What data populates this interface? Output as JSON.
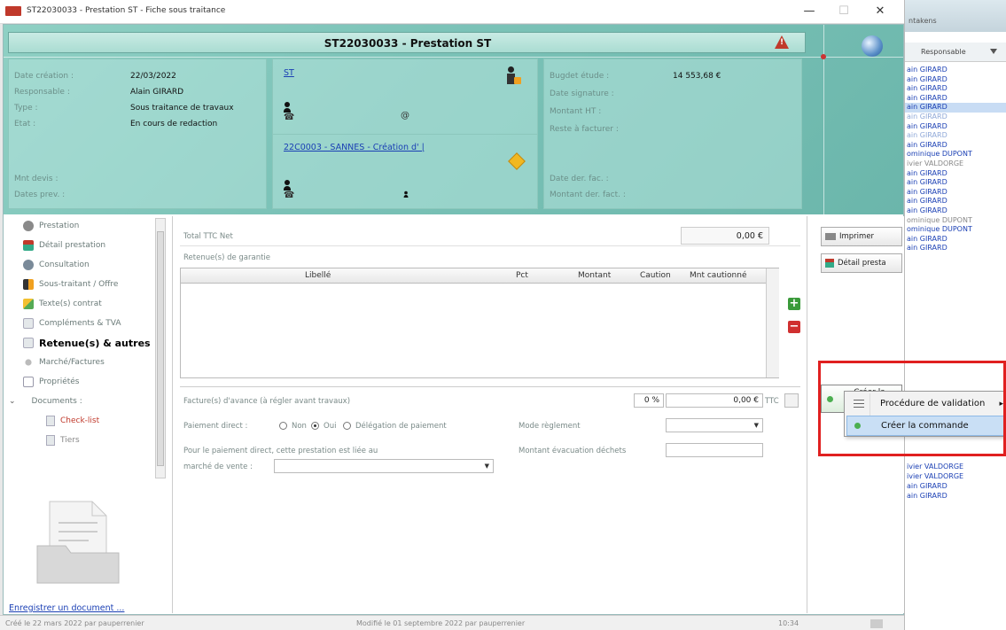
{
  "window": {
    "title": "ST22030033 - Prestation ST - Fiche sous traitance",
    "minimize": "—",
    "maximize": "☐",
    "close": "✕"
  },
  "header": {
    "doc_title": "ST22030033 - Prestation ST",
    "left": {
      "date_creation_label": "Date création :",
      "date_creation": "22/03/2022",
      "responsable_label": "Responsable :",
      "responsable": "Alain GIRARD",
      "type_label": "Type :",
      "type": "Sous traitance de travaux",
      "etat_label": "Etat :",
      "etat": "En cours de redaction",
      "mnt_devis_label": "Mnt devis :",
      "dates_prev_label": "Dates prev. :"
    },
    "middle": {
      "st_link": "ST",
      "at_symbol": "@",
      "phone_symbol": "☎",
      "project_link": "22C0003 - SANNES - Création d' |"
    },
    "right": {
      "budget_label": "Bugdet étude :",
      "budget_value": "14 553,68 €",
      "date_signature_label": "Date signature :",
      "montant_ht_label": "Montant HT :",
      "reste_label": "Reste à facturer :",
      "date_der_fac_label": "Date der. fac. :",
      "montant_der_label": "Montant der. fact. :"
    }
  },
  "nav": {
    "items": [
      {
        "label": "Prestation",
        "icon": "gear-icon"
      },
      {
        "label": "Détail prestation",
        "icon": "chart-icon"
      },
      {
        "label": "Consultation",
        "icon": "users-icon"
      },
      {
        "label": "Sous-traitant / Offre",
        "icon": "worker-icon"
      },
      {
        "label": "Texte(s) contrat",
        "icon": "pen-icon"
      },
      {
        "label": "Compléments & TVA",
        "icon": "doc-icon"
      },
      {
        "label": "Retenue(s) & autres",
        "icon": "doc-icon"
      },
      {
        "label": "Marché/Factures",
        "icon": "dot-icon"
      },
      {
        "label": "Propriétés",
        "icon": "page-icon"
      },
      {
        "label": "Documents :",
        "icon": "chevron-down-icon"
      }
    ],
    "sub_items": [
      {
        "label": "Check-list"
      },
      {
        "label": "Tiers"
      }
    ],
    "save_link": "Enregistrer un document ..."
  },
  "form": {
    "total_ttc_label": "Total TTC Net",
    "total_ttc_value": "0,00 €",
    "retenues_label": "Retenue(s) de garantie",
    "grid_headers": [
      "Libellé",
      "Pct",
      "Montant",
      "Caution",
      "Mnt cautionné"
    ],
    "factures_label": "Facture(s) d'avance (à régler avant travaux)",
    "pct_value": "0 %",
    "amount_value": "0,00 €",
    "ttc_suffix": "TTC",
    "paiement_direct_label": "Paiement direct :",
    "radio_non": "Non",
    "radio_oui": "Oui",
    "radio_delegation": "Délégation de paiement",
    "mode_reglement_label": "Mode règlement",
    "pour_paiement_label": "Pour le paiement direct, cette prestation est liée au",
    "marche_vente_label": "marché de vente :",
    "montant_evac_label": "Montant évacuation déchets"
  },
  "actions": {
    "imprimer": "Imprimer",
    "detail_presta": "Détail presta",
    "creer_line1": "Créer la",
    "creer_line2": "commande"
  },
  "context_menu": {
    "items": [
      {
        "label": "Procédure de validation",
        "arrow": "▸"
      },
      {
        "label": "Créer la commande"
      }
    ]
  },
  "status": {
    "created": "Créé le 22 mars 2022 par pauperrenier",
    "modified": "Modifié le 01 septembre 2022 par pauperrenier",
    "time": "10:34"
  },
  "background_list": {
    "tab": "ntakens",
    "column": "Responsable",
    "rows": [
      {
        "name": "ain GIRARD",
        "style": ""
      },
      {
        "name": "ain GIRARD",
        "style": ""
      },
      {
        "name": "ain GIRARD",
        "style": ""
      },
      {
        "name": "ain GIRARD",
        "style": ""
      },
      {
        "name": "ain GIRARD",
        "style": "sel"
      },
      {
        "name": "ain GIRARD",
        "style": "faded"
      },
      {
        "name": "ain GIRARD",
        "style": ""
      },
      {
        "name": "ain GIRARD",
        "style": "faded"
      },
      {
        "name": "ain GIRARD",
        "style": ""
      },
      {
        "name": "ominique DUPONT",
        "style": ""
      },
      {
        "name": "ivier VALDORGE",
        "style": "grey"
      },
      {
        "name": "ain GIRARD",
        "style": ""
      },
      {
        "name": "ain GIRARD",
        "style": ""
      },
      {
        "name": "ain GIRARD",
        "style": ""
      },
      {
        "name": "ain GIRARD",
        "style": ""
      },
      {
        "name": "ain GIRARD",
        "style": ""
      },
      {
        "name": "ominique DUPONT",
        "style": "grey"
      },
      {
        "name": "ominique DUPONT",
        "style": ""
      },
      {
        "name": "ain GIRARD",
        "style": ""
      },
      {
        "name": "ain GIRARD",
        "style": ""
      }
    ],
    "rows_bottom": [
      {
        "name": "ivier VALDORGE",
        "style": ""
      },
      {
        "name": "ivier VALDORGE",
        "style": ""
      },
      {
        "name": "ain GIRARD",
        "style": ""
      },
      {
        "name": "ain GIRARD",
        "style": ""
      }
    ]
  },
  "colors": {
    "teal": "#7cc3b8",
    "link": "#1a3fb4",
    "highlight": "#e02020",
    "accent_green": "#4caf50"
  }
}
